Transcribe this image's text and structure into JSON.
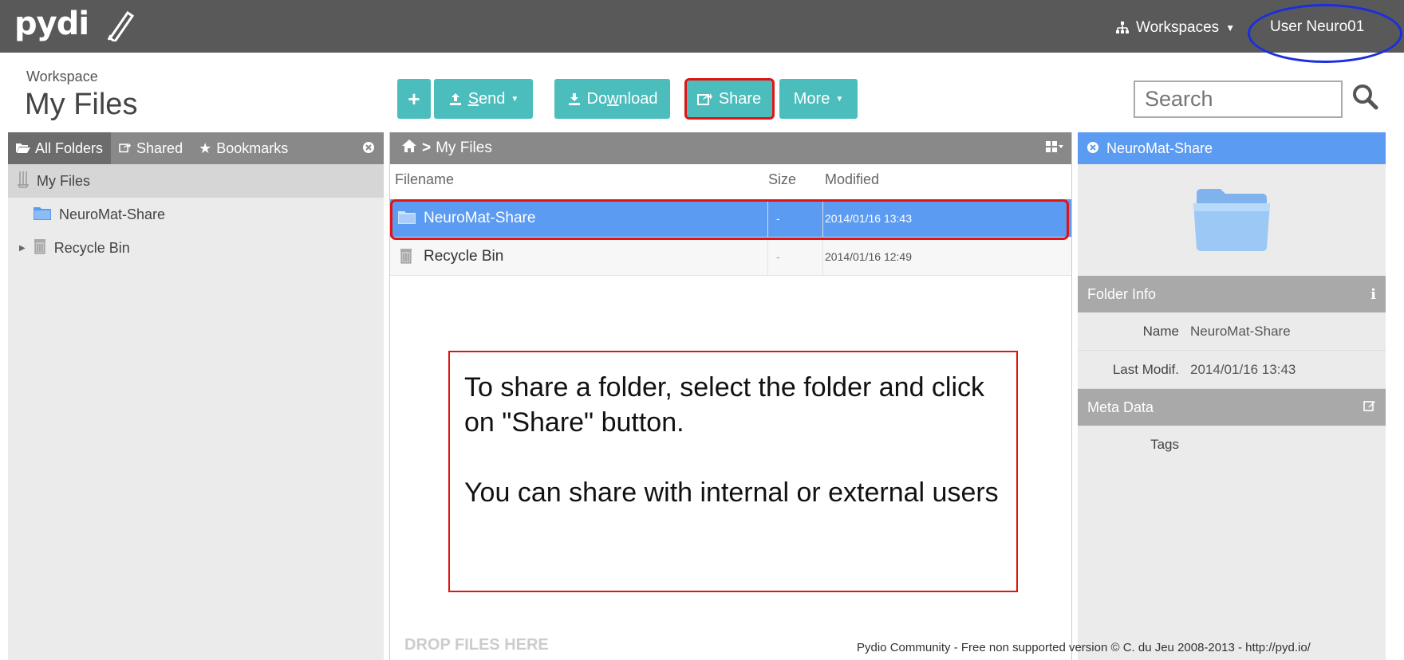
{
  "app": {
    "logo": "pydi",
    "workspaces_label": "Workspaces",
    "user_label": "User Neuro01"
  },
  "header": {
    "workspace_small": "Workspace",
    "workspace_title": "My Files"
  },
  "toolbar": {
    "add": "+",
    "send_underlined": "S",
    "send_rest": "end",
    "download_prefix": "Do",
    "download_underlined": "w",
    "download_rest": "nload",
    "share": "Share",
    "more": "More"
  },
  "search": {
    "placeholder": "Search"
  },
  "left_panel": {
    "tabs": [
      "All Folders",
      "Shared",
      "Bookmarks"
    ],
    "tree": [
      {
        "label": "My Files"
      },
      {
        "label": "NeuroMat-Share"
      },
      {
        "label": "Recycle Bin"
      }
    ]
  },
  "center": {
    "breadcrumb": "My Files",
    "columns": {
      "filename": "Filename",
      "size": "Size",
      "modified": "Modified"
    },
    "rows": [
      {
        "name": "NeuroMat-Share",
        "size": "-",
        "modified": "2014/01/16 13:43",
        "selected": true
      },
      {
        "name": "Recycle Bin",
        "size": "-",
        "modified": "2014/01/16 12:49",
        "selected": false
      }
    ],
    "drop_label": "DROP FILES HERE"
  },
  "right_panel": {
    "title": "NeuroMat-Share",
    "folder_info_label": "Folder Info",
    "name_label": "Name",
    "name_value": "NeuroMat-Share",
    "modif_label": "Last Modif.",
    "modif_value": "2014/01/16 13:43",
    "meta_label": "Meta Data",
    "tags_label": "Tags"
  },
  "note": {
    "line1": "To share a folder, select the folder and click on \"Share\" button.",
    "line2": "You can share with internal or external users"
  },
  "footer": "Pydio Community - Free non supported version © C. du Jeu 2008-2013 - http://pyd.io/",
  "colors": {
    "topbar": "#595959",
    "accent_teal": "#4bbdbd",
    "selection_blue": "#5c9bf2",
    "highlight_red": "#e01414",
    "ellipse_blue": "#1a2ee0"
  }
}
